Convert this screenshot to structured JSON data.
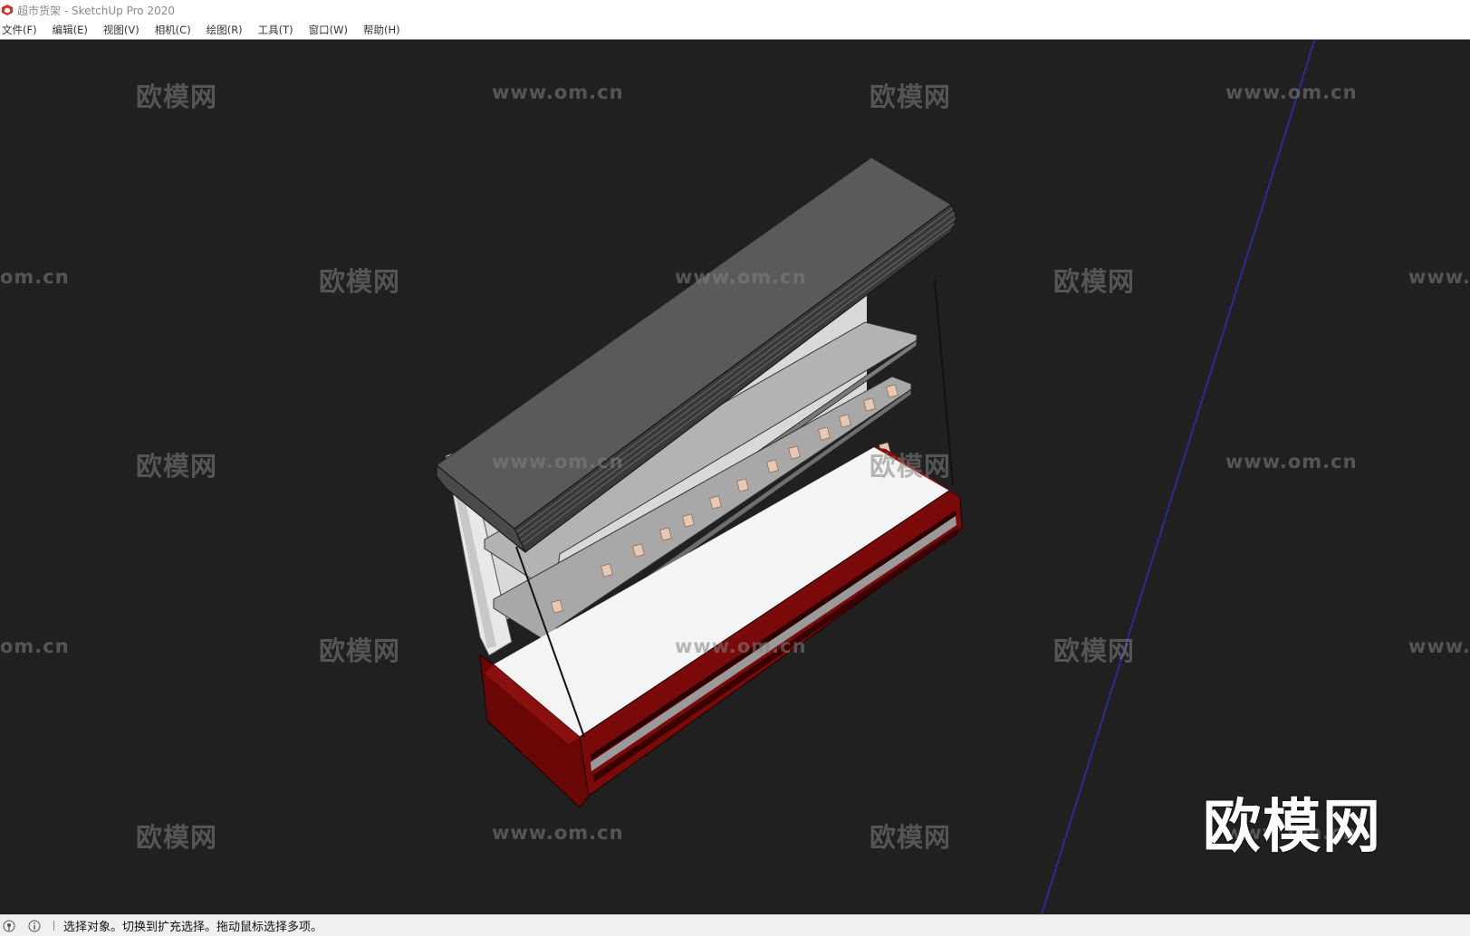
{
  "window": {
    "title": "超市货架 - SketchUp Pro 2020",
    "app_icon": "sketchup-logo-icon"
  },
  "menu": {
    "items": [
      "文件(F)",
      "编辑(E)",
      "视图(V)",
      "相机(C)",
      "绘图(R)",
      "工具(T)",
      "窗口(W)",
      "帮助(H)"
    ]
  },
  "viewport": {
    "background": "#202020",
    "model": "supermarket-refrigerated-shelf",
    "colors": {
      "canopy": "#5a5a5a",
      "shelf": "#b3b3b3",
      "base_red": "#7a0a0a",
      "deck": "#f4f4f4",
      "axis_blue": "#2a2a9a"
    },
    "watermarks": {
      "brand": "欧模网",
      "url": "www.om.cn",
      "url_fragment_left": "om.cn",
      "url_fragment_right": "www."
    },
    "brand_logo": "欧模网"
  },
  "statusbar": {
    "icons": [
      "geo-location-icon",
      "info-icon"
    ],
    "message": "选择对象。切换到扩充选择。拖动鼠标选择多项。"
  }
}
